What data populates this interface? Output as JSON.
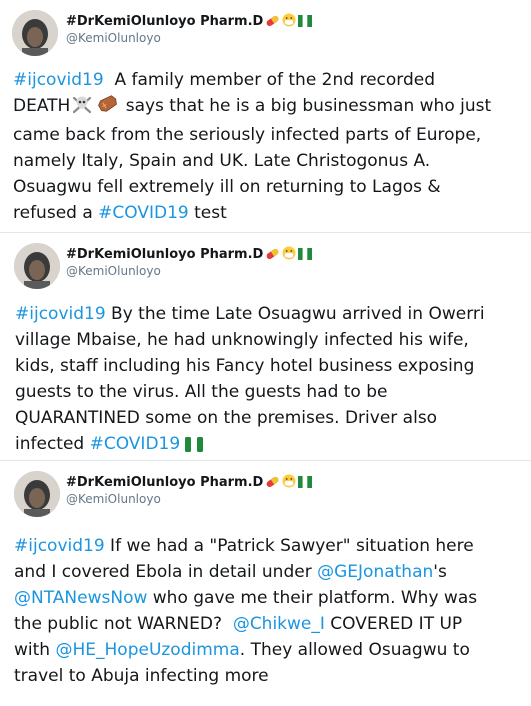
{
  "tweets": [
    {
      "author_name": "#DrKemiOlunloyo Pharm.D",
      "author_handle": "@KemiOlunloyo",
      "lines": [
        [
          "#ijcovid19",
          "  A family member of the 2nd recorded"
        ],
        [
          "DEATH",
          "",
          " says that he is a big businessman who just"
        ],
        [
          "came back from the seriously infected parts of Europe,"
        ],
        [
          "namely Italy, Spain and UK. Late Christogonus A."
        ],
        [
          "Osuagwu fell extremely ill on returning to Lagos &"
        ],
        [
          "refused a ",
          "#COVID19",
          " test"
        ]
      ]
    },
    {
      "author_name": "#DrKemiOlunloyo Pharm.D",
      "author_handle": "@KemiOlunloyo",
      "lines": [
        [
          "#ijcovid19",
          " By the time Late Osuagwu arrived in Owerri"
        ],
        [
          "village Mbaise, he had unknowingly infected his wife,"
        ],
        [
          "kids, staff including his Fancy hotel business exposing"
        ],
        [
          "guests to the virus. All the guests had to be"
        ],
        [
          "QUARANTINED some on the premises. Driver also"
        ],
        [
          "infected ",
          "#COVID19"
        ]
      ]
    },
    {
      "author_name": "#DrKemiOlunloyo Pharm.D",
      "author_handle": "@KemiOlunloyo",
      "lines": [
        [
          "#ijcovid19",
          " If we had a \"Patrick Sawyer\" situation here"
        ],
        [
          "and I covered Ebola in detail under ",
          "@GEJonathan",
          "'s"
        ],
        [
          "@NTANewsNow",
          " who gave me their platform. Why was"
        ],
        [
          "the public not WARNED?  ",
          "@Chikwe_I",
          " COVERED IT UP"
        ],
        [
          "with ",
          "@HE_HopeUzodimma",
          ". They allowed Osuagwu to"
        ],
        [
          "travel to Abuja infecting more"
        ]
      ]
    }
  ],
  "icons": {
    "name_suffix": [
      "pill-icon",
      "face-with-mask-icon",
      "nigeria-flag-icon"
    ],
    "death_suffix": [
      "skull-and-crossbones-icon",
      "coffin-icon"
    ],
    "tweet2_end": "nigeria-flag-icon"
  },
  "colors": {
    "link": "#1b95e0",
    "handle": "#657786",
    "text": "#14171a",
    "divider": "#e1e8ed"
  }
}
